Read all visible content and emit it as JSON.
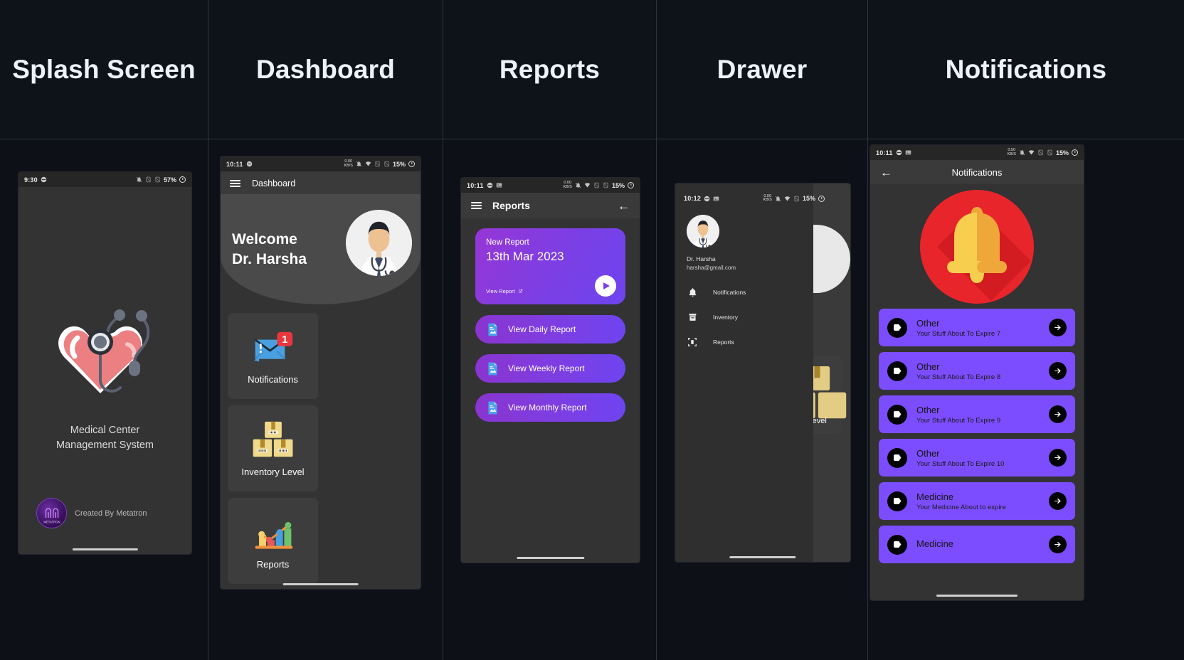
{
  "columns": [
    {
      "heading": "Splash Screen"
    },
    {
      "heading": "Dashboard"
    },
    {
      "heading": "Reports"
    },
    {
      "heading": "Drawer"
    },
    {
      "heading": "Notifications"
    }
  ],
  "splash": {
    "statusbar": {
      "time": "9:30",
      "battery": "57%"
    },
    "app_title_line1": "Medical Center",
    "app_title_line2": "Management System",
    "credit": "Created By Metatron",
    "logo_text": "METATRON"
  },
  "dashboard": {
    "statusbar": {
      "time": "10:11",
      "net_rate": "0.00",
      "net_unit": "KB/S",
      "battery": "15%"
    },
    "navbar_title": "Dashboard",
    "welcome_line1": "Welcome",
    "welcome_line2": "Dr. Harsha",
    "tiles": [
      {
        "label": "Notifications",
        "badge": "1"
      },
      {
        "label": "Inventory Level",
        "badge": ""
      },
      {
        "label": "Reports",
        "badge": ""
      }
    ]
  },
  "reports": {
    "statusbar": {
      "time": "10:11",
      "net_rate": "0.00",
      "net_unit": "KB/S",
      "battery": "15%"
    },
    "navbar_title": "Reports",
    "card": {
      "label": "New Report",
      "date": "13th Mar 2023",
      "view_link": "View Report"
    },
    "items": [
      {
        "label": "View Daily Report"
      },
      {
        "label": "View Weekly Report"
      },
      {
        "label": "View Monthly Report"
      }
    ]
  },
  "drawer": {
    "statusbar": {
      "time": "10:12",
      "net_rate": "0.00",
      "net_unit": "KB/S",
      "battery": "15%"
    },
    "user_name": "Dr. Harsha",
    "user_email": "harsha@gmail.com",
    "menu": [
      {
        "label": "Notifications",
        "icon": "bell-icon"
      },
      {
        "label": "Inventory",
        "icon": "inventory-box-icon"
      },
      {
        "label": "Reports",
        "icon": "reports-frame-icon"
      }
    ],
    "peek_label": "y Level"
  },
  "notifications": {
    "statusbar": {
      "time": "10:11",
      "net_rate": "0.50",
      "net_unit": "KB/S",
      "battery": "15%"
    },
    "navbar_title": "Notifications",
    "items": [
      {
        "title": "Other",
        "subtitle": "Your Stuff About To Expire 7"
      },
      {
        "title": "Other",
        "subtitle": "Your Stuff About To Expire 8"
      },
      {
        "title": "Other",
        "subtitle": "Your Stuff About To Expire 9"
      },
      {
        "title": "Other",
        "subtitle": "Your Stuff About To Expire 10"
      },
      {
        "title": "Medicine",
        "subtitle": "Your Medicine About to expire"
      },
      {
        "title": "Medicine",
        "subtitle": ""
      }
    ]
  },
  "colors": {
    "page_bg": "#0d1117",
    "phone_surface": "#333333",
    "accent_purple": "#7c4dff",
    "card_gradient_start": "#9636d6",
    "card_gradient_end": "#6e44f0",
    "bell_red": "#e8252b",
    "badge_red": "#e8383d"
  }
}
